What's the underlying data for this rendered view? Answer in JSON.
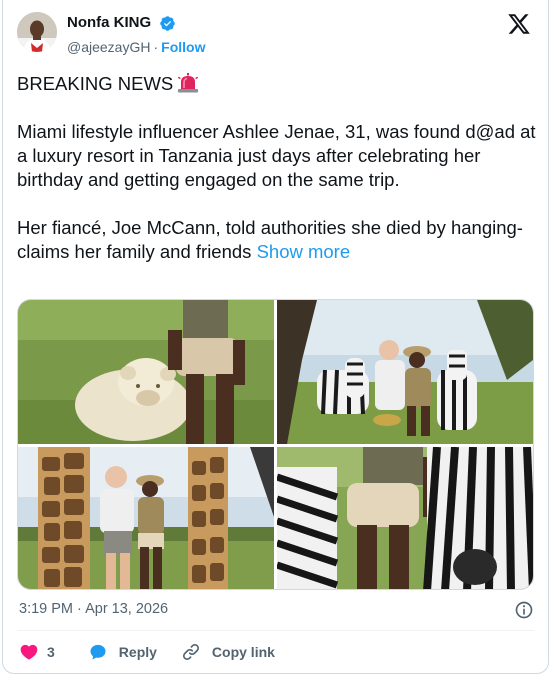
{
  "author": {
    "display_name": "Nonfa KING",
    "handle": "@ajeezayGH",
    "separator": "·",
    "follow_label": "Follow",
    "verified_icon": "verified-badge-icon",
    "verified_color": "#1d9bf0"
  },
  "tweet": {
    "headline": "BREAKING NEWS",
    "headline_emoji": "siren-icon",
    "paragraph_1": "Miami lifestyle influencer Ashlee Jenae, 31, was found d@ad at a luxury resort in Tanzania just days after celebrating her birthday and getting engaged on the same trip.",
    "paragraph_2": "Her fiancé, Joe McCann, told authorities she died by hanging-claims her family and friends",
    "show_more_label": "Show more"
  },
  "media": {
    "photos": [
      {
        "subject": "lioness-with-woman-photo"
      },
      {
        "subject": "couple-with-zebras-photo"
      },
      {
        "subject": "couple-with-giraffes-photo"
      },
      {
        "subject": "woman-with-zebra-photo"
      }
    ]
  },
  "meta": {
    "timestamp": "3:19 PM · Apr 13, 2026"
  },
  "actions": {
    "like_count": "3",
    "reply_label": "Reply",
    "copy_link_label": "Copy link"
  },
  "colors": {
    "accent": "#1d9bf0",
    "like": "#f91880",
    "text_primary": "#0f1419",
    "text_secondary": "#536471"
  }
}
